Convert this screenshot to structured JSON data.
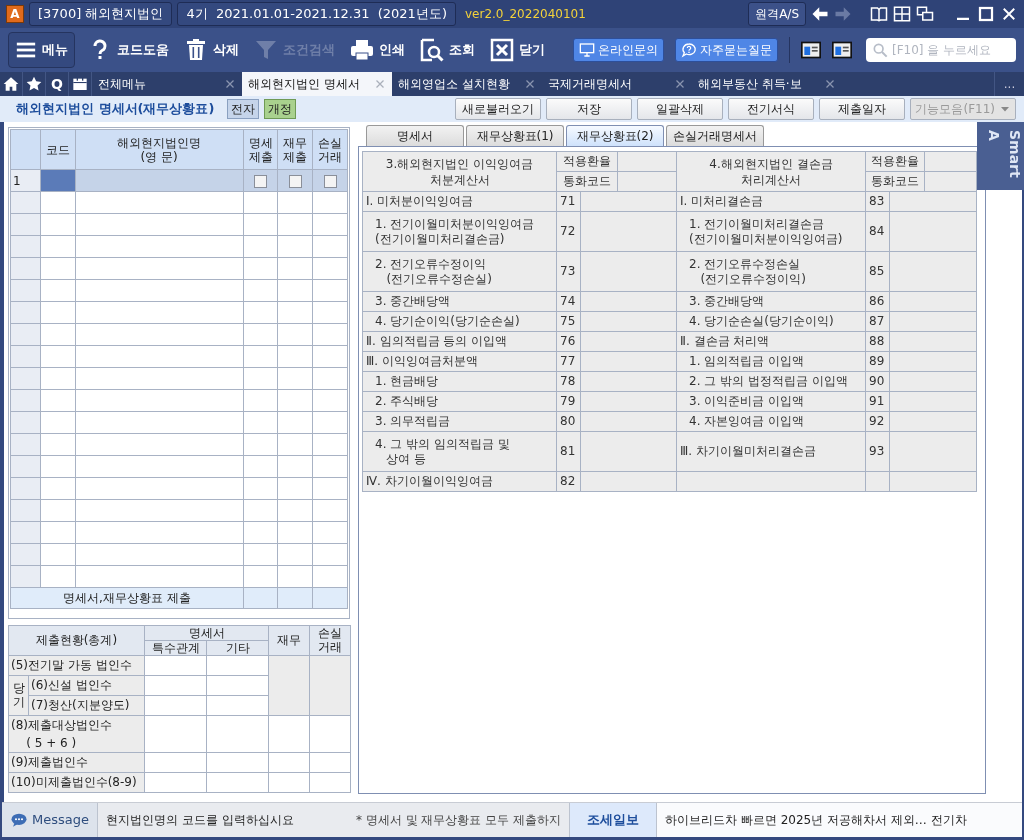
{
  "title_bar": {
    "logo": "A",
    "screen": "[3700] 해외현지법인",
    "period": "4기  2021.01.01-2021.12.31  (2021년도)",
    "version": "ver2.0_2022040101",
    "remote_button": "원격A/S",
    "nav": [
      {
        "kind": "back",
        "disabled": false
      },
      {
        "kind": "forward",
        "disabled": true
      }
    ]
  },
  "toolbar": {
    "buttons": [
      {
        "label": "메뉴",
        "kind": "menu",
        "disabled": false
      },
      {
        "label": "코드도움",
        "kind": "help",
        "disabled": false
      },
      {
        "label": "삭제",
        "kind": "trash",
        "disabled": false
      },
      {
        "label": "조건검색",
        "kind": "filter",
        "disabled": true
      },
      {
        "label": "인쇄",
        "kind": "printer",
        "disabled": false
      },
      {
        "label": "조회",
        "kind": "lookup",
        "disabled": false
      },
      {
        "label": "닫기",
        "kind": "closebox",
        "disabled": false
      }
    ],
    "links": [
      {
        "label": "온라인문의",
        "kind": "monitor"
      },
      {
        "label": "자주묻는질문",
        "kind": "faq"
      }
    ],
    "search": {
      "placeholder": "[F10] 을 누르세요"
    }
  },
  "tab_bar": {
    "quick_letter": "Q",
    "tabs": [
      {
        "label": "전체메뉴",
        "selected": false
      },
      {
        "label": "해외현지법인 명세서",
        "selected": true
      },
      {
        "label": "해외영업소 설치현황",
        "selected": false
      },
      {
        "label": "국제거래명세서",
        "selected": false
      },
      {
        "label": "해외부동산 취득·보",
        "selected": false
      }
    ],
    "more": "..."
  },
  "header": {
    "title": "해외현지법인 명세서(재무상황표)",
    "badges": [
      {
        "label": "전자",
        "kind": "efile"
      },
      {
        "label": "개정",
        "kind": "revised"
      }
    ],
    "buttons": [
      {
        "label": "새로불러오기",
        "disabled": false
      },
      {
        "label": "저장",
        "disabled": false
      },
      {
        "label": "일괄삭제",
        "disabled": false
      },
      {
        "label": "전기서식",
        "disabled": false
      },
      {
        "label": "제출일자",
        "disabled": false
      },
      {
        "label": "기능모음(F11)",
        "disabled": true,
        "dropdown": true
      }
    ]
  },
  "corp_grid": {
    "columns": [
      "코드",
      "해외현지법인명\n(영  문)",
      "명세\n제출",
      "재무\n제출",
      "손실\n거래"
    ],
    "rows": [
      {
        "number": "1",
        "selected": true,
        "checks": [
          {
            "checked": false
          },
          {
            "checked": false
          },
          {
            "checked": false
          }
        ]
      }
    ],
    "footer": "명세서,재무상황표 제출"
  },
  "summary": {
    "title": "제출현황(총계)",
    "group": "명세서",
    "subcolumns": [
      "특수관계",
      "기타"
    ],
    "finance": "재무",
    "loss": "손실\n거래",
    "current_label": "당\n기",
    "rows": [
      {
        "label": "(5)전기말 가동 법인수",
        "kind": "top"
      },
      {
        "label": "(6)신설 법인수",
        "kind": "current"
      },
      {
        "label": "(7)청산(지분양도)",
        "kind": "current"
      },
      {
        "label": "(8)제출대상법인수\n    ( 5 + 6 )",
        "kind": "plain"
      },
      {
        "label": "(9)제출법인수",
        "kind": "plain"
      },
      {
        "label": "(10)미제출법인수(8-9)",
        "kind": "plain"
      }
    ]
  },
  "form_tabs": [
    {
      "label": "명세서",
      "selected": false
    },
    {
      "label": "재무상황표(1)",
      "selected": false
    },
    {
      "label": "재무상황표(2)",
      "selected": true
    },
    {
      "label": "손실거래명세서",
      "selected": false
    }
  ],
  "statement": {
    "headers": [
      {
        "title": "3.해외현지법인 이익잉여금\n처분계산서",
        "rate_label": "적용환율",
        "currency_label": "통화코드"
      },
      {
        "title": "4.해외현지법인 결손금\n처리계산서",
        "rate_label": "적용환율",
        "currency_label": "통화코드"
      }
    ],
    "rows": [
      {
        "left": {
          "label": "Ⅰ. 미처분이익잉여금",
          "code": "71",
          "kind": "section"
        },
        "right": {
          "label": "Ⅰ. 미처리결손금",
          "code": "83",
          "kind": "section"
        }
      },
      {
        "left": {
          "label": "1. 전기이월미처분이익잉여금\n(전기이월미처리결손금)",
          "code": "72",
          "kind": "item"
        },
        "right": {
          "label": "1. 전기이월미처리결손금\n(전기이월미처분이익잉여금)",
          "code": "84",
          "kind": "item"
        }
      },
      {
        "left": {
          "label": "2. 전기오류수정이익\n   (전기오류수정손실)",
          "code": "73",
          "kind": "item"
        },
        "right": {
          "label": "2. 전기오류수정손실\n   (전기오류수정이익)",
          "code": "85",
          "kind": "item"
        }
      },
      {
        "left": {
          "label": "3. 중간배당액",
          "code": "74",
          "kind": "item"
        },
        "right": {
          "label": "3. 중간배당액",
          "code": "86",
          "kind": "item"
        }
      },
      {
        "left": {
          "label": "4. 당기순이익(당기순손실)",
          "code": "75",
          "kind": "item"
        },
        "right": {
          "label": "4. 당기순손실(당기순이익)",
          "code": "87",
          "kind": "item"
        }
      },
      {
        "left": {
          "label": "Ⅱ. 임의적립금 등의 이입액",
          "code": "76",
          "kind": "section"
        },
        "right": {
          "label": "Ⅱ. 결손금 처리액",
          "code": "88",
          "kind": "section"
        }
      },
      {
        "left": {
          "label": "Ⅲ. 이익잉여금처분액",
          "code": "77",
          "kind": "section"
        },
        "right": {
          "label": "1. 임의적립금 이입액",
          "code": "89",
          "kind": "item"
        }
      },
      {
        "left": {
          "label": "1. 현금배당",
          "code": "78",
          "kind": "item"
        },
        "right": {
          "label": "2. 그 밖의 법정적립금 이입액",
          "code": "90",
          "kind": "item"
        }
      },
      {
        "left": {
          "label": "2. 주식배당",
          "code": "79",
          "kind": "item"
        },
        "right": {
          "label": "3. 이익준비금 이입액",
          "code": "91",
          "kind": "item"
        }
      },
      {
        "left": {
          "label": "3. 의무적립금",
          "code": "80",
          "kind": "item"
        },
        "right": {
          "label": "4. 자본잉여금 이입액",
          "code": "92",
          "kind": "item"
        }
      },
      {
        "left": {
          "label": "4. 그 밖의 임의적립금 및\n   상여 등",
          "code": "81",
          "kind": "item"
        },
        "right": {
          "label": "Ⅲ. 차기이월미처리결손금",
          "code": "93",
          "kind": "section"
        }
      },
      {
        "left": {
          "label": "Ⅳ. 차기이월이익잉여금",
          "code": "82",
          "kind": "section"
        },
        "right": null
      }
    ]
  },
  "side_tab": "Smart A",
  "status_bar": {
    "message_label": "Message",
    "message": "현지법인명의 코드를 입력하십시요",
    "notice": "* 명세서 및 재무상황표 모두 제출하지",
    "news_source": "조세일보",
    "headline": "하이브리드차 빠르면 2025년 저공해차서 제외… 전기차"
  }
}
